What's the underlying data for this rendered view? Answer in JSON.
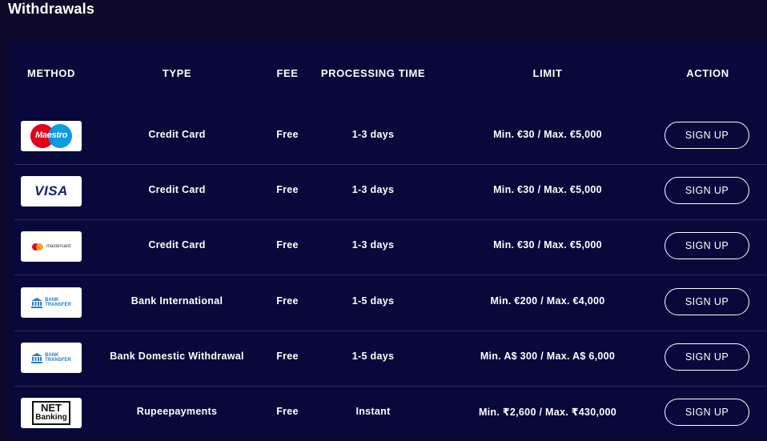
{
  "page": {
    "title": "Withdrawals"
  },
  "table": {
    "headers": {
      "method": "METHOD",
      "type": "TYPE",
      "fee": "FEE",
      "processing_time": "PROCESSING TIME",
      "limit": "LIMIT",
      "action": "ACTION"
    },
    "rows": [
      {
        "method_logo": "maestro-logo",
        "logo_text": "Maestro",
        "type": "Credit Card",
        "fee": "Free",
        "processing_time": "1-3 days",
        "limit": "Min. €30 / Max. €5,000",
        "action": "SIGN UP"
      },
      {
        "method_logo": "visa-logo",
        "logo_text": "VISA",
        "type": "Credit Card",
        "fee": "Free",
        "processing_time": "1-3 days",
        "limit": "Min. €30 / Max. €5,000",
        "action": "SIGN UP"
      },
      {
        "method_logo": "mastercard-logo",
        "logo_text": "mastercard",
        "type": "Credit Card",
        "fee": "Free",
        "processing_time": "1-3 days",
        "limit": "Min. €30 / Max. €5,000",
        "action": "SIGN UP"
      },
      {
        "method_logo": "bank-transfer-logo",
        "logo_text_1": "BANK",
        "logo_text_2": "TRANSFER",
        "type": "Bank International",
        "fee": "Free",
        "processing_time": "1-5 days",
        "limit": "Min. €200 / Max. €4,000",
        "action": "SIGN UP"
      },
      {
        "method_logo": "bank-transfer-logo",
        "logo_text_1": "BANK",
        "logo_text_2": "TRANSFER",
        "type": "Bank Domestic Withdrawal",
        "fee": "Free",
        "processing_time": "1-5 days",
        "limit": "Min. A$ 300 / Max. A$ 6,000",
        "action": "SIGN UP"
      },
      {
        "method_logo": "net-banking-logo",
        "logo_text_1": "NET",
        "logo_text_2": "Banking",
        "type": "Rupeepayments",
        "fee": "Free",
        "processing_time": "Instant",
        "limit": "Min. ₹2,600 / Max. ₹430,000",
        "action": "SIGN UP"
      }
    ]
  },
  "colors": {
    "page_background": "#0f0a2a",
    "panel_background": "#08083a",
    "row_divider": "#2a2a5a",
    "text": "#ffffff"
  }
}
